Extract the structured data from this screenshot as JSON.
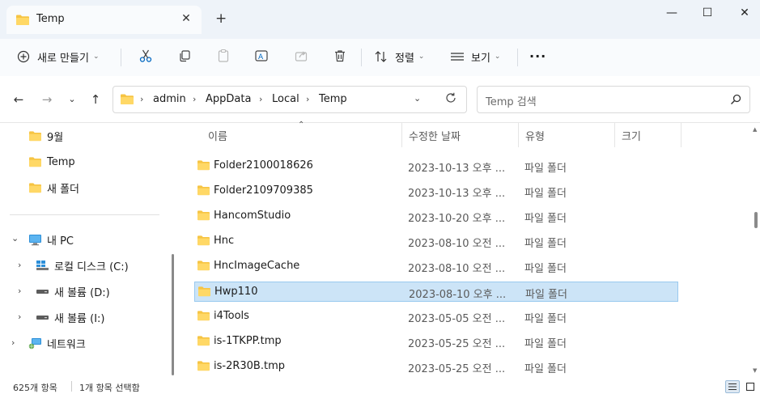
{
  "window": {
    "tab_title": "Temp",
    "tab_close": "✕",
    "new_tab": "+",
    "minimize": "—",
    "maximize": "☐",
    "close": "✕"
  },
  "toolbar": {
    "new_label": "새로 만들기",
    "sort_label": "정렬",
    "view_label": "보기",
    "more": "···"
  },
  "address": {
    "path": [
      "admin",
      "AppData",
      "Local",
      "Temp"
    ]
  },
  "search": {
    "placeholder": "Temp 검색"
  },
  "sidebar": {
    "quick": [
      "9월",
      "Temp",
      "새 폴더"
    ],
    "pc_label": "내 PC",
    "drives": [
      "로컬 디스크 (C:)",
      "새 볼륨 (D:)",
      "새 볼륨 (I:)"
    ],
    "network_label": "네트워크"
  },
  "columns": {
    "name": "이름",
    "date": "수정한 날짜",
    "type": "유형",
    "size": "크기"
  },
  "files": [
    {
      "name": "Folder2100018626",
      "date": "2023-10-13 오후 ...",
      "type": "파일 폴더"
    },
    {
      "name": "Folder2109709385",
      "date": "2023-10-13 오후 ...",
      "type": "파일 폴더"
    },
    {
      "name": "HancomStudio",
      "date": "2023-10-20 오후 ...",
      "type": "파일 폴더"
    },
    {
      "name": "Hnc",
      "date": "2023-08-10 오전 ...",
      "type": "파일 폴더"
    },
    {
      "name": "HncImageCache",
      "date": "2023-08-10 오전 ...",
      "type": "파일 폴더"
    },
    {
      "name": "Hwp110",
      "date": "2023-08-10 오후 ...",
      "type": "파일 폴더"
    },
    {
      "name": "i4Tools",
      "date": "2023-05-05 오전 ...",
      "type": "파일 폴더"
    },
    {
      "name": "is-1TKPP.tmp",
      "date": "2023-05-25 오전 ...",
      "type": "파일 폴더"
    },
    {
      "name": "is-2R30B.tmp",
      "date": "2023-05-25 오전 ...",
      "type": "파일 폴더"
    }
  ],
  "status": {
    "count": "625개 항목",
    "selected": "1개 항목 선택함"
  },
  "colors": {
    "folder": "#f6c443",
    "selection": "#cce4f7",
    "accent": "#0067c0"
  }
}
